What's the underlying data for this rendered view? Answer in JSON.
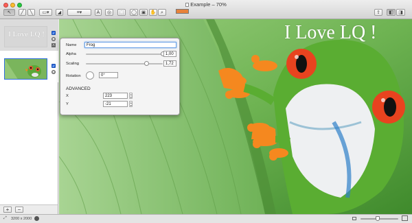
{
  "window": {
    "title": "Example – 70%",
    "traffic_lights": {
      "close": "#ff5f57",
      "minimize": "#ffbd2e",
      "zoom": "#28c940"
    }
  },
  "toolbar": {
    "tools": [
      {
        "icon": "pointer-arrow-icon",
        "glyph": "↖"
      },
      {
        "icon": "pen-icon",
        "glyph": "╱"
      },
      {
        "icon": "line-icon",
        "glyph": "╲"
      },
      {
        "icon": "rectangle-shape-icon",
        "glyph": "▭▾"
      },
      {
        "icon": "eraser-icon",
        "glyph": "◢"
      },
      {
        "icon": "line-width-icon",
        "glyph": "≡▾"
      },
      {
        "icon": "text-tool-icon",
        "glyph": "A"
      },
      {
        "icon": "image-adjust-icon",
        "glyph": "◎"
      },
      {
        "icon": "crop-select-icon",
        "glyph": "⬚"
      },
      {
        "icon": "lasso-icon",
        "glyph": "◯"
      },
      {
        "icon": "stamp-icon",
        "glyph": "▣"
      },
      {
        "icon": "hand-icon",
        "glyph": "✋"
      },
      {
        "icon": "zoom-search-icon",
        "glyph": "⌕"
      }
    ],
    "color": "#e8823a",
    "right": [
      {
        "icon": "share-icon",
        "glyph": "⇪"
      },
      {
        "icon": "sidebar-toggle-icon",
        "glyph": "◧"
      },
      {
        "icon": "inspector-toggle-icon",
        "glyph": "◨"
      }
    ]
  },
  "layers": [
    {
      "name": "text-layer",
      "thumb_text": "I Love LQ !"
    },
    {
      "name": "frog-layer"
    }
  ],
  "canvas": {
    "overlay_text": "I Love LQ !"
  },
  "inspector": {
    "name_label": "Name",
    "name_value": "Frog",
    "alpha_label": "Alpha",
    "alpha_value": "1,00",
    "alpha_fraction": 1.0,
    "scaling_label": "Scaling",
    "scaling_value": "1,72",
    "scaling_fraction": 0.79,
    "rotation_label": "Rotation",
    "rotation_value": "0°",
    "advanced_label": "ADVANCED",
    "x_label": "X",
    "x_value": "223",
    "y_label": "Y",
    "y_value": "-21"
  },
  "sidebar_buttons": {
    "add": "+",
    "remove": "−"
  },
  "status": {
    "dimensions": "3200 x 2000",
    "zoom_fraction": 0.45
  }
}
